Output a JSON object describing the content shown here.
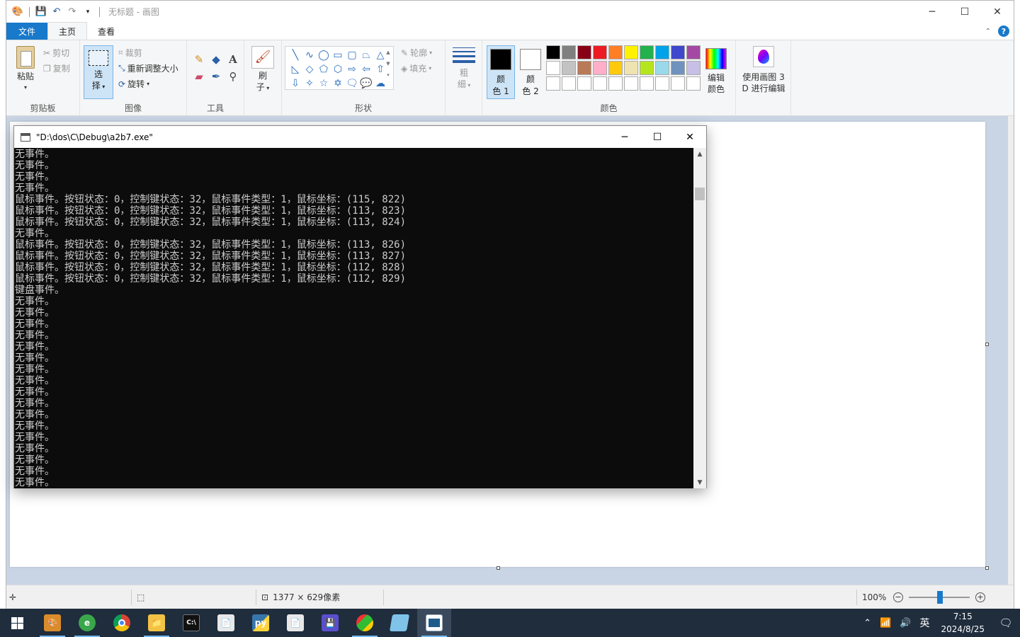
{
  "paint": {
    "title": "无标题 - 画图",
    "tabs": {
      "file": "文件",
      "home": "主页",
      "view": "查看"
    },
    "clipboard": {
      "paste": "粘贴",
      "cut": "剪切",
      "copy": "复制",
      "label": "剪贴板"
    },
    "image": {
      "select_1": "选",
      "select_2": "择",
      "crop": "裁剪",
      "resize": "重新调整大小",
      "rotate": "旋转",
      "label": "图像"
    },
    "tools": {
      "label": "工具",
      "brush_1": "刷",
      "brush_2": "子"
    },
    "shapes": {
      "outline": "轮廓",
      "fill": "填充",
      "label": "形状"
    },
    "size": {
      "line1": "粗",
      "line2": "细"
    },
    "colors": {
      "color1_a": "颜",
      "color1_b": "色 1",
      "color2_a": "颜",
      "color2_b": "色 2",
      "edit_a": "编辑",
      "edit_b": "颜色",
      "label": "颜色",
      "palette_row1": [
        "#000000",
        "#7f7f7f",
        "#880015",
        "#ed1c24",
        "#ff7f27",
        "#fff200",
        "#22b14c",
        "#00a2e8",
        "#3f48cc",
        "#a349a4"
      ],
      "palette_row2": [
        "#ffffff",
        "#c3c3c3",
        "#b97a57",
        "#ffaec9",
        "#ffc90e",
        "#efe4b0",
        "#b5e61d",
        "#99d9ea",
        "#7092be",
        "#c8bfe7"
      ],
      "palette_row3": [
        "#ffffff",
        "#ffffff",
        "#ffffff",
        "#ffffff",
        "#ffffff",
        "#ffffff",
        "#ffffff",
        "#ffffff",
        "#ffffff",
        "#ffffff"
      ]
    },
    "paint3d": {
      "line1": "使用画图 3",
      "line2": "D 进行编辑"
    },
    "status": {
      "image_size": "1377 × 629像素",
      "zoom": "100%"
    }
  },
  "console": {
    "title": "\"D:\\dos\\C\\Debug\\a2b7.exe\"",
    "lines": [
      "无事件。",
      "无事件。",
      "无事件。",
      "无事件。",
      "鼠标事件。按钮状态：0，控制键状态：32，鼠标事件类型：1，鼠标坐标：(115, 822)",
      "鼠标事件。按钮状态：0，控制键状态：32，鼠标事件类型：1，鼠标坐标：(113, 823)",
      "鼠标事件。按钮状态：0，控制键状态：32，鼠标事件类型：1，鼠标坐标：(113, 824)",
      "无事件。",
      "鼠标事件。按钮状态：0，控制键状态：32，鼠标事件类型：1，鼠标坐标：(113, 826)",
      "鼠标事件。按钮状态：0，控制键状态：32，鼠标事件类型：1，鼠标坐标：(113, 827)",
      "鼠标事件。按钮状态：0，控制键状态：32，鼠标事件类型：1，鼠标坐标：(112, 828)",
      "鼠标事件。按钮状态：0，控制键状态：32，鼠标事件类型：1，鼠标坐标：(112, 829)",
      "键盘事件。",
      "无事件。",
      "无事件。",
      "无事件。",
      "无事件。",
      "无事件。",
      "无事件。",
      "无事件。",
      "无事件。",
      "无事件。",
      "无事件。",
      "无事件。",
      "无事件。",
      "无事件。",
      "无事件。",
      "无事件。",
      "无事件。",
      "无事件。"
    ]
  },
  "taskbar": {
    "apps": [
      "paint-app-icon",
      "ie-icon",
      "chrome-icon",
      "file-explorer-icon",
      "cmd-icon",
      "document-icon",
      "python-icon",
      "document-icon-2",
      "save-disk-icon",
      "media-app-icon",
      "notepad-icon",
      "console-app-icon"
    ],
    "ime": "英",
    "time": "7:15",
    "date": "2024/8/25"
  }
}
